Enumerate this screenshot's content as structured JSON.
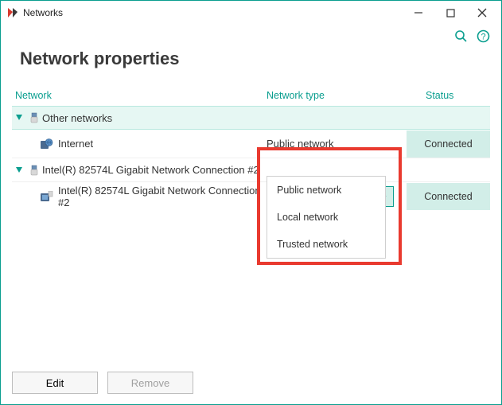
{
  "titlebar": {
    "title": "Networks"
  },
  "page": {
    "heading": "Network properties"
  },
  "columns": {
    "network": "Network",
    "type": "Network type",
    "status": "Status"
  },
  "groups": {
    "other": {
      "label": "Other networks"
    },
    "adapter": {
      "label": "Intel(R) 82574L Gigabit Network Connection #2"
    }
  },
  "rows": {
    "internet": {
      "name": "Internet",
      "type": "Public network",
      "status": "Connected"
    },
    "adapter_child": {
      "name": "Intel(R) 82574L Gigabit Network Connection #2",
      "type_selected": "Trusted network",
      "status": "Connected"
    }
  },
  "dropdown": {
    "options": {
      "a": "Public network",
      "b": "Local network",
      "c": "Trusted network"
    }
  },
  "footer": {
    "edit": "Edit",
    "remove": "Remove"
  },
  "colors": {
    "accent": "#0a9e8f",
    "highlight_border": "#e93a2f"
  }
}
